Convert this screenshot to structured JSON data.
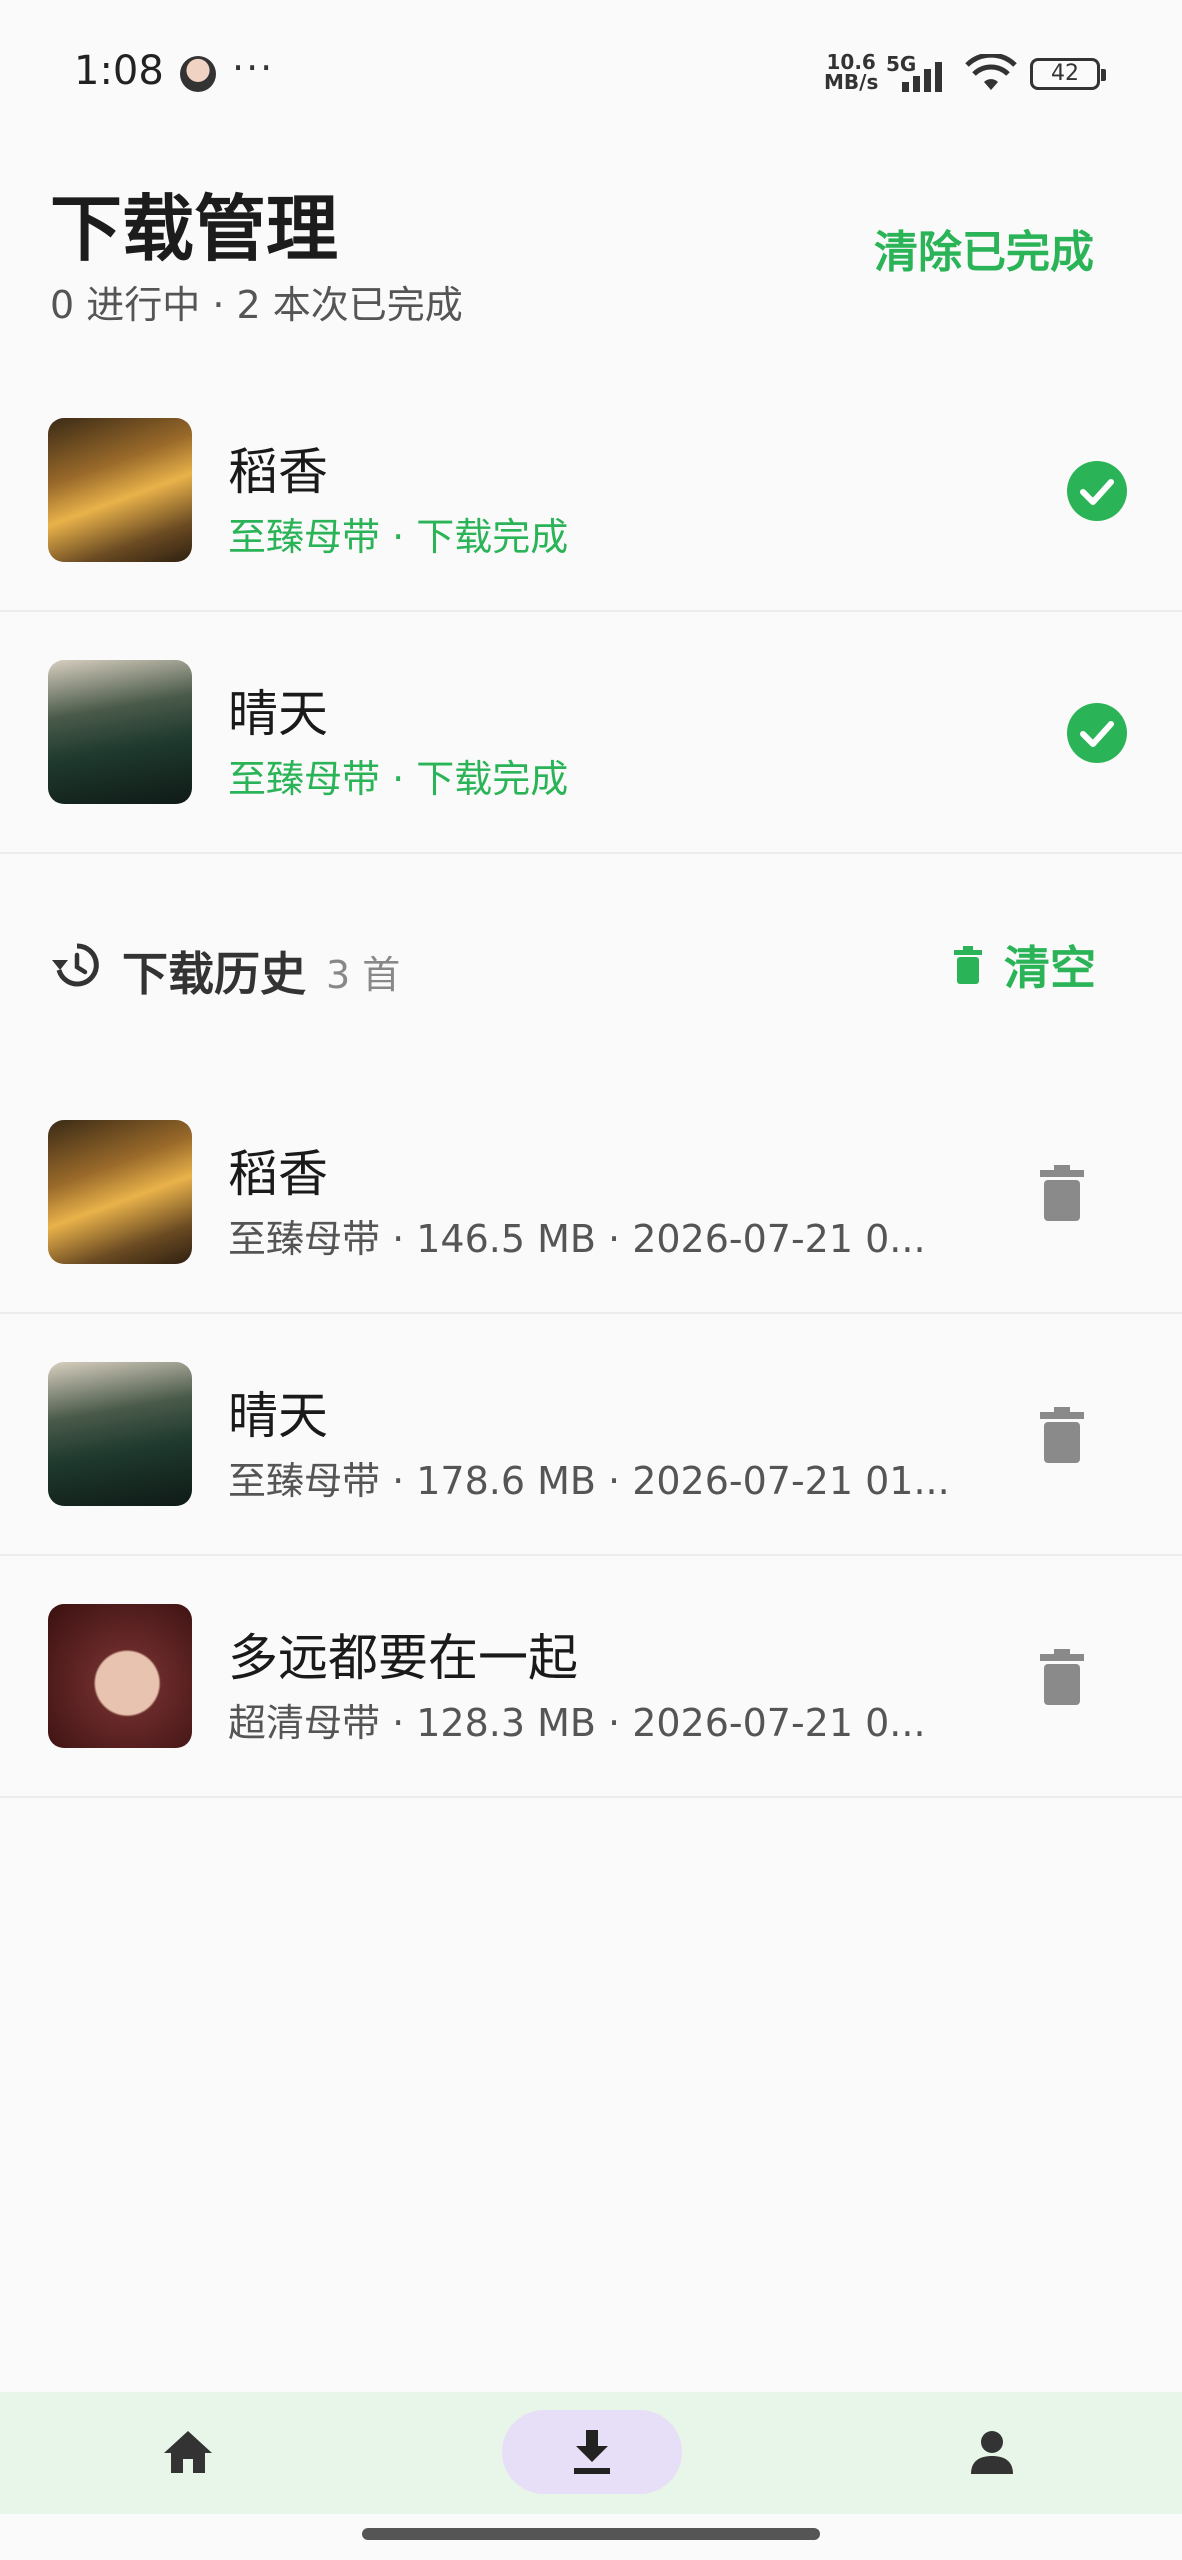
{
  "status": {
    "time": "1:08",
    "dots": "···",
    "net_speed": "10.6",
    "net_unit": "MB/s",
    "network": "5G",
    "battery": "42"
  },
  "header": {
    "title": "下载管理",
    "subtitle": "0 进行中 · 2 本次已完成",
    "clear_completed": "清除已完成"
  },
  "active_downloads": [
    {
      "title": "稻香",
      "meta": "至臻母带 · 下载完成"
    },
    {
      "title": "晴天",
      "meta": "至臻母带 · 下载完成"
    }
  ],
  "history": {
    "title": "下载历史",
    "count": "3 首",
    "clear_label": "清空",
    "items": [
      {
        "title": "稻香",
        "meta": "至臻母带 · 146.5 MB · 2026-07-21 0..."
      },
      {
        "title": "晴天",
        "meta": "至臻母带 · 178.6 MB · 2026-07-21 01..."
      },
      {
        "title": "多远都要在一起",
        "meta": "超清母带 · 128.3 MB · 2026-07-21 0..."
      }
    ]
  },
  "nav": {
    "items": [
      "home-icon",
      "download-icon",
      "person-icon"
    ],
    "active": "download"
  },
  "colors": {
    "accent": "#2bb457",
    "nav_bg": "#e8f6ea",
    "nav_active_pill": "#e7def7"
  }
}
